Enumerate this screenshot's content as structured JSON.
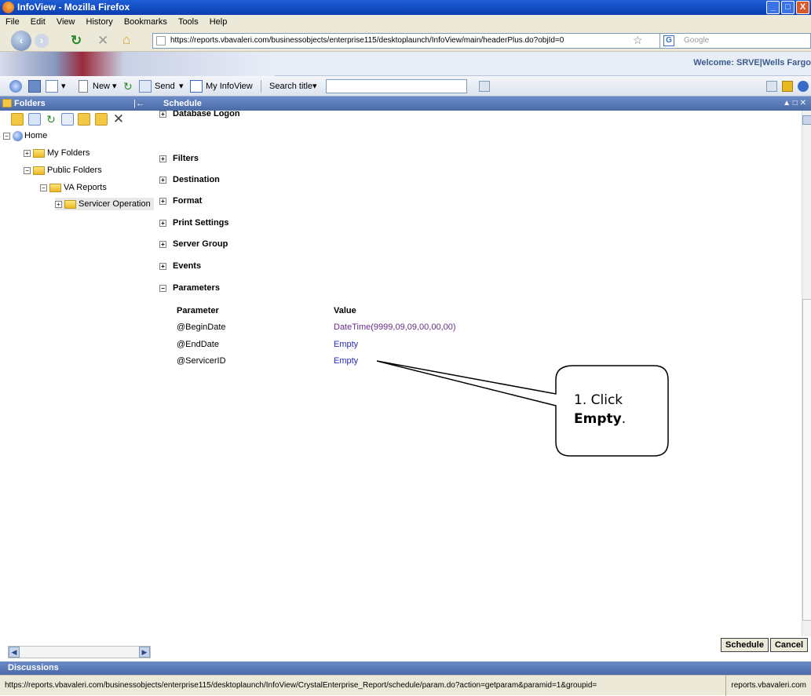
{
  "window": {
    "title": "InfoView - Mozilla Firefox",
    "min": "_",
    "max": "□",
    "close": "X"
  },
  "menu": [
    "File",
    "Edit",
    "View",
    "History",
    "Bookmarks",
    "Tools",
    "Help"
  ],
  "nav": {
    "url": "https://reports.vbavaleri.com/businessobjects/enterprise115/desktoplaunch/InfoView/main/headerPlus.do?objId=0",
    "search_engine": "Google",
    "star": "☆"
  },
  "banner": {
    "welcome": "Welcome: SRVE|Wells Fargo"
  },
  "toolbar": {
    "new": "New",
    "send": "Send",
    "my_infoview": "My InfoView",
    "search_title": "Search title"
  },
  "folders": {
    "title": "Folders",
    "collapse": "|←",
    "tree": [
      "Home",
      "My Folders",
      "Public Folders",
      "VA Reports",
      "Servicer Operation"
    ]
  },
  "schedule": {
    "title": "Schedule",
    "partial_section": "Database Logon",
    "sections": [
      "Filters",
      "Destination",
      "Format",
      "Print Settings",
      "Server Group",
      "Events",
      "Parameters"
    ],
    "param_header": "Parameter",
    "value_header": "Value",
    "params": [
      {
        "name": "@BeginDate",
        "value": "DateTime(9999,09,09,00,00,00)"
      },
      {
        "name": "@EndDate",
        "value": "Empty"
      },
      {
        "name": "@ServicerID",
        "value": "Empty"
      }
    ]
  },
  "buttons": {
    "schedule": "Schedule",
    "cancel": "Cancel"
  },
  "discussions": "Discussions",
  "status": {
    "url": "https://reports.vbavaleri.com/businessobjects/enterprise115/desktoplaunch/InfoView/CrystalEnterprise_Report/schedule/param.do?action=getparam&paramid=1&groupid=",
    "host": "reports.vbavaleri.com"
  },
  "callout": {
    "step": "1. Click",
    "target": "Empty",
    "period": "."
  },
  "colors": {
    "param_value_purple": "#6a2a8a",
    "param_value_blue": "#2a2ab8"
  }
}
